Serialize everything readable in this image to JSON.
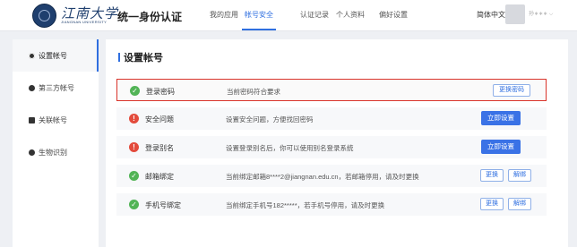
{
  "header": {
    "logo_text": "江南大学",
    "logo_sub": "JIANGNAN UNIVERSITY",
    "app_title": "统一身份认证",
    "nav": [
      {
        "label": "我的应用",
        "active": false
      },
      {
        "label": "帐号安全",
        "active": true
      },
      {
        "label": "认证记录",
        "active": false
      },
      {
        "label": "个人资料",
        "active": false
      },
      {
        "label": "偏好设置",
        "active": false
      }
    ],
    "language": "简体中文 ⌵",
    "username": "孙∗∗∗ ⌵"
  },
  "sidebar": {
    "items": [
      {
        "label": "设置帐号",
        "icon": "gear-icon",
        "active": true
      },
      {
        "label": "第三方帐号",
        "icon": "link-icon",
        "active": false
      },
      {
        "label": "关联帐号",
        "icon": "account-icon",
        "active": false
      },
      {
        "label": "生物识别",
        "icon": "person-icon",
        "active": false
      }
    ]
  },
  "main": {
    "title": "设置帐号",
    "rows": [
      {
        "status": "ok",
        "label": "登录密码",
        "desc": "当前密码符合要求",
        "buttons": [
          {
            "label": "更换密码",
            "style": "outline"
          }
        ]
      },
      {
        "status": "warn",
        "label": "安全问题",
        "desc": "设置安全问题，方便找回密码",
        "buttons": [
          {
            "label": "立即设置",
            "style": "primary"
          }
        ]
      },
      {
        "status": "warn",
        "label": "登录别名",
        "desc": "设置登录别名后，你可以使用别名登录系统",
        "buttons": [
          {
            "label": "立即设置",
            "style": "primary"
          }
        ]
      },
      {
        "status": "ok",
        "label": "邮箱绑定",
        "desc": "当前绑定邮箱8****2@jiangnan.edu.cn，若邮箱停用，请及时更换",
        "buttons": [
          {
            "label": "更换",
            "style": "outline"
          },
          {
            "label": "解绑",
            "style": "outline"
          }
        ]
      },
      {
        "status": "ok",
        "label": "手机号绑定",
        "desc": "当前绑定手机号182*****，若手机号停用，请及时更换",
        "buttons": [
          {
            "label": "更换",
            "style": "outline"
          },
          {
            "label": "解绑",
            "style": "outline"
          }
        ]
      }
    ]
  },
  "colors": {
    "accent": "#2f6fe0",
    "ok": "#52b456",
    "warn": "#e34b3c",
    "highlight_border": "#d9342b"
  }
}
